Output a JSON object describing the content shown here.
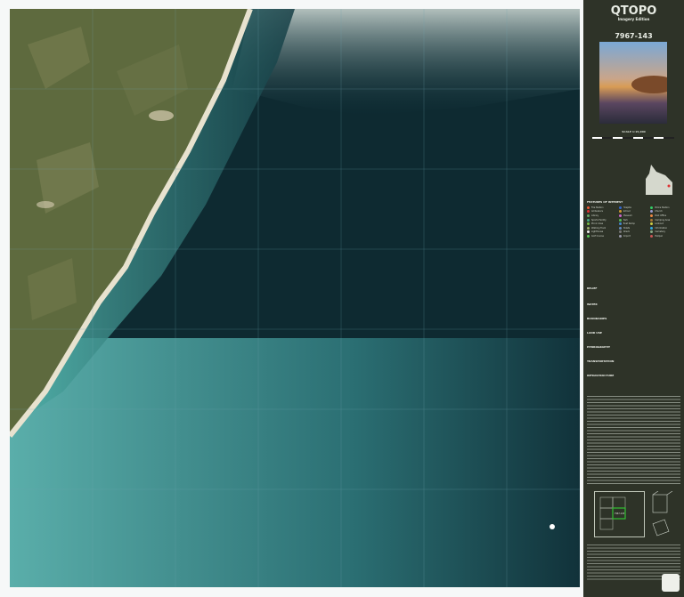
{
  "header": {
    "title": "QTOPO",
    "subtitle": "Imagery Edition",
    "sheet_number": "7967-143"
  },
  "scale_text": "SCALE 1:15,000",
  "colors": {
    "panel": "#2e3328",
    "sea_deep": "#0f2a30",
    "sea_shallow": "#3f9a98",
    "sand": "#e8e2cf",
    "land": "#5e6a3e",
    "grid": "#6fa4b0",
    "index_highlight": "#34c034"
  },
  "legend": {
    "headings": [
      "FEATURES OF INTEREST",
      "RELIEF",
      "WATER",
      "BOUNDARIES",
      "LAND USE",
      "HYDROGRAPHY",
      "TRANSPORTATION",
      "INFRASTRUCTURE"
    ],
    "items": [
      "Fire Station",
      "Hospital",
      "Police Station",
      "Ambulance",
      "School",
      "Church",
      "Library",
      "Museum",
      "Post Office",
      "Sports Facility",
      "Park",
      "Camping Area",
      "Picnic Area",
      "Boat Ramp",
      "Lookout",
      "Walking Track",
      "Toilets",
      "Information",
      "Lighthouse",
      "Wreck",
      "Cemetery",
      "Golf Course",
      "Airport",
      "Helipad",
      "Parking",
      "Fuel",
      "Caravan Park",
      "Shelter",
      "Jetty",
      "Marina",
      "Barbecue",
      "Drinking Water",
      "Swimming",
      "Surfing",
      "Fishing",
      "Diving",
      "Whale Watching",
      "Wildlife",
      "Beach",
      "Reef",
      "Waterfall",
      "Spring",
      "Cave",
      "Peak",
      "Dam",
      "Weir",
      "Bore",
      "Tank"
    ]
  },
  "index_map": {
    "sheets": [
      "7967-141",
      "7967-142",
      "7967-143",
      "7967-144",
      "7967-145",
      "7967-146"
    ],
    "highlighted": "7967-143"
  }
}
